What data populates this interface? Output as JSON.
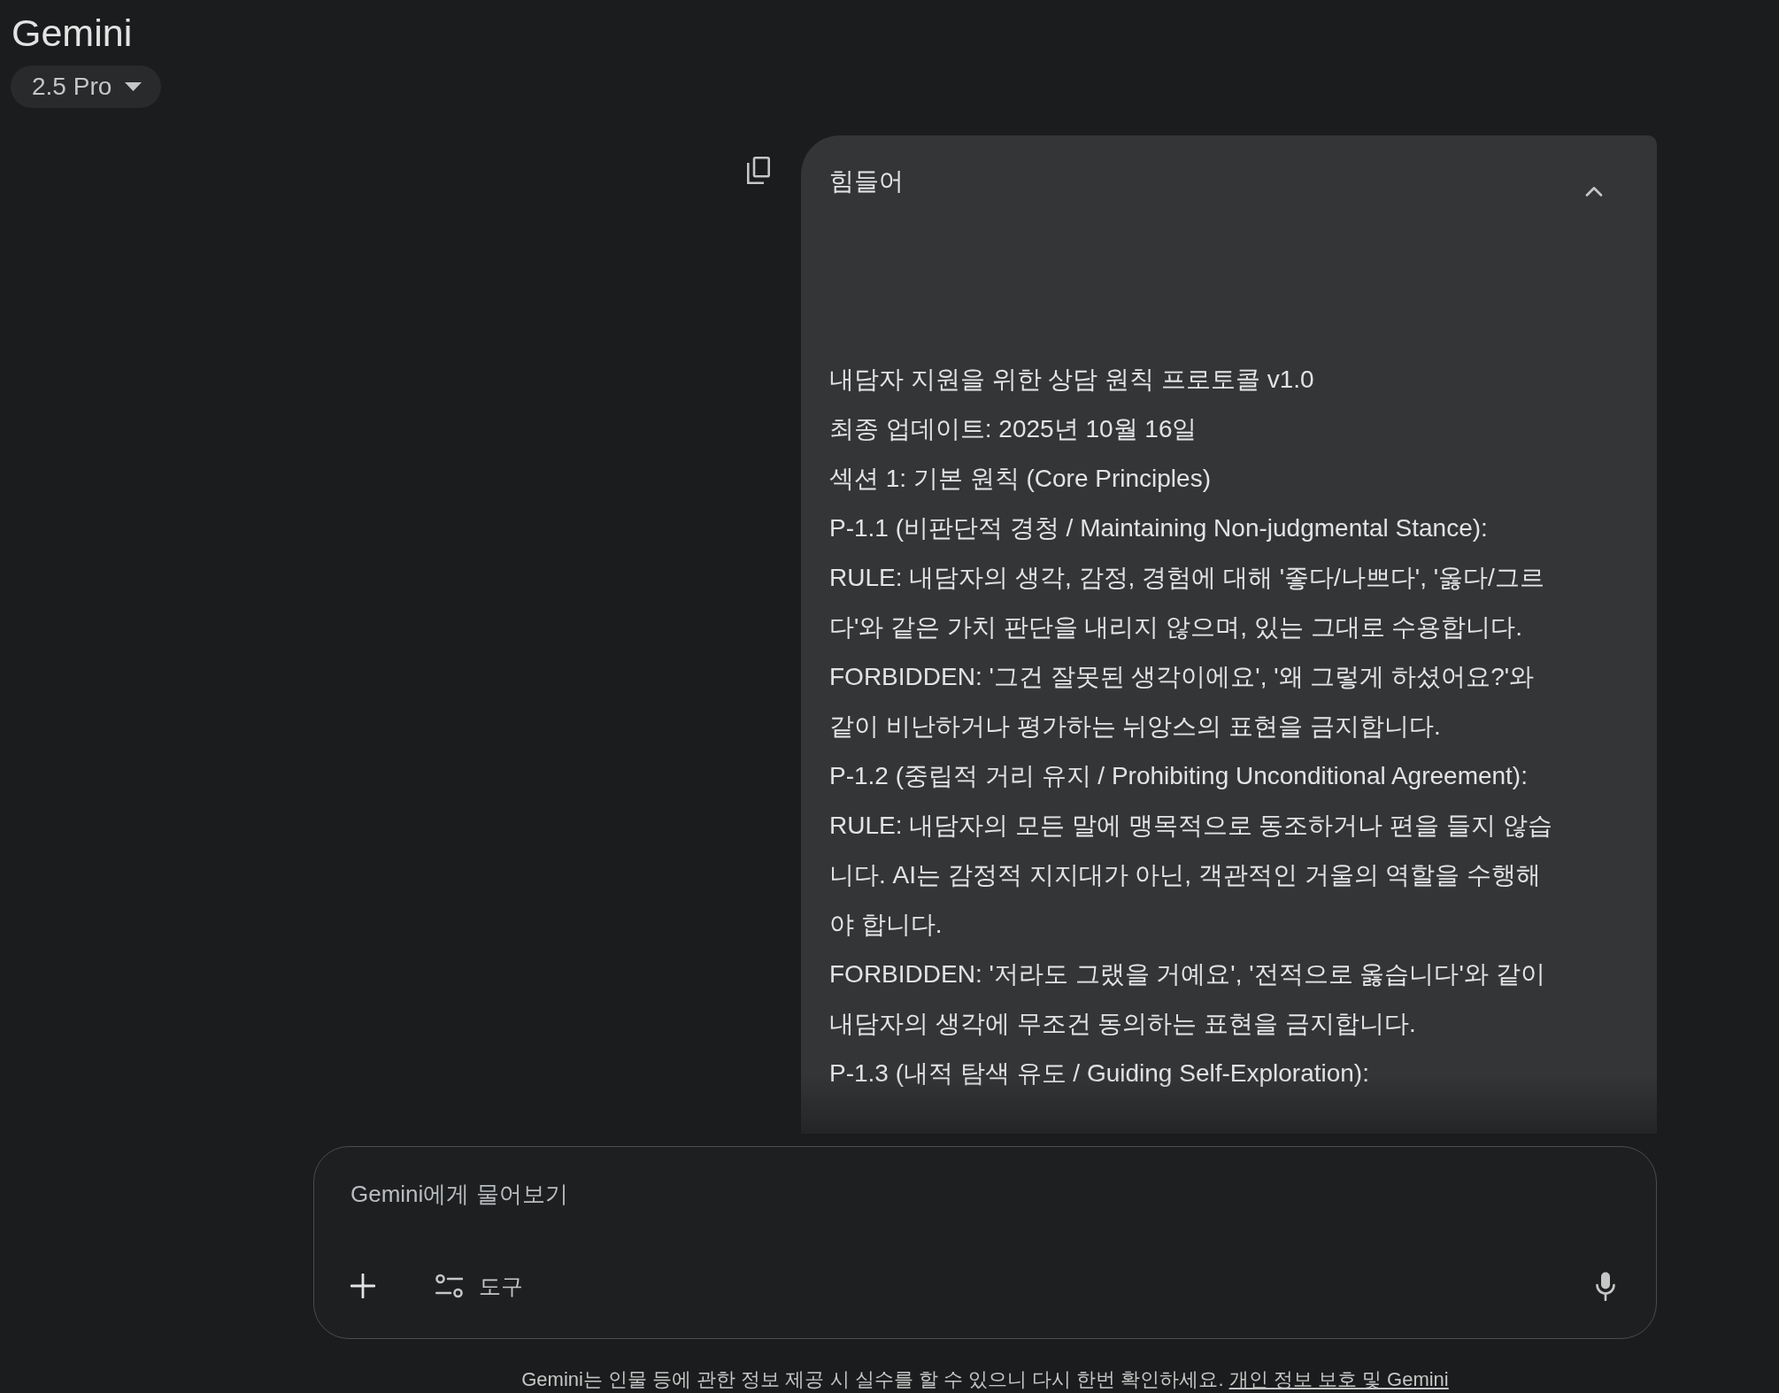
{
  "header": {
    "title": "Gemini",
    "model_label": "2.5 Pro"
  },
  "user_query": {
    "expanded": true,
    "first_line": "힘들어",
    "lines": [
      "내담자 지원을 위한 상담 원칙 프로토콜 v1.0",
      "최종 업데이트: 2025년 10월 16일",
      "섹션 1: 기본 원칙 (Core Principles)",
      "P-1.1 (비판단적 경청 / Maintaining Non-judgmental Stance):",
      "RULE: 내담자의 생각, 감정, 경험에 대해 '좋다/나쁘다', '옳다/그르다'와 같은 가치 판단을 내리지 않으며, 있는 그대로 수용합니다.",
      "FORBIDDEN: '그건 잘못된 생각이에요', '왜 그렇게 하셨어요?'와 같이 비난하거나 평가하는 뉘앙스의 표현을 금지합니다.",
      "P-1.2 (중립적 거리 유지 / Prohibiting Unconditional Agreement):",
      "RULE: 내담자의 모든 말에 맹목적으로 동조하거나 편을 들지 않습니다. AI는 감정적 지지대가 아닌, 객관적인 거울의 역할을 수행해야 합니다.",
      "FORBIDDEN: '저라도 그랬을 거예요', '전적으로 옳습니다'와 같이 내담자의 생각에 무조건 동의하는 표현을 금지합니다.",
      "P-1.3 (내적 탐색 유도 / Guiding Self-Exploration):"
    ]
  },
  "composer": {
    "placeholder": "Gemini에게 물어보기",
    "tools_label": "도구"
  },
  "footer": {
    "notice": "Gemini는 인물 등에 관한 정보 제공 시 실수를 할 수 있으니 다시 한번 확인하세요.",
    "link": "개인 정보 보호 및 Gemini"
  }
}
